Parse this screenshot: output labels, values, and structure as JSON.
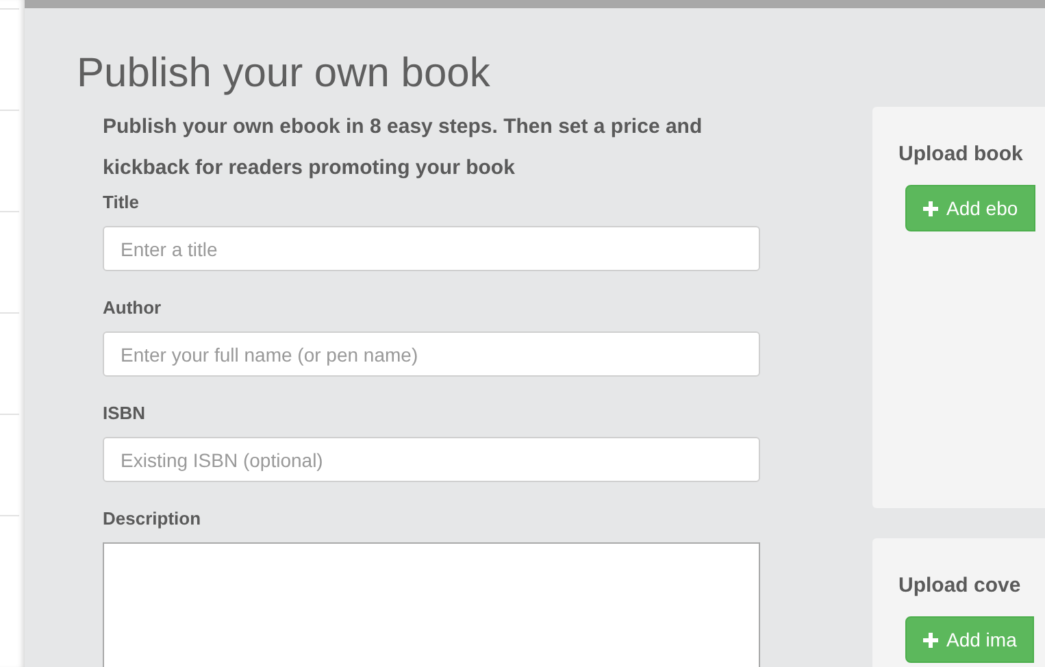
{
  "heading": "Publish your own book",
  "intro": "Publish your own ebook in 8 easy steps. Then set a price and kickback for readers promoting your book",
  "fields": [
    {
      "kind": "input",
      "label": "Title",
      "placeholder": "Enter a title"
    },
    {
      "kind": "input",
      "label": "Author",
      "placeholder": "Enter your full name (or pen name)"
    },
    {
      "kind": "input",
      "label": "ISBN",
      "placeholder": "Existing ISBN (optional)"
    },
    {
      "kind": "textarea",
      "label": "Description"
    }
  ],
  "upload_cards": [
    {
      "title": "Upload book",
      "button": "Add ebo"
    },
    {
      "title": "Upload cove",
      "button": "Add ima"
    }
  ]
}
